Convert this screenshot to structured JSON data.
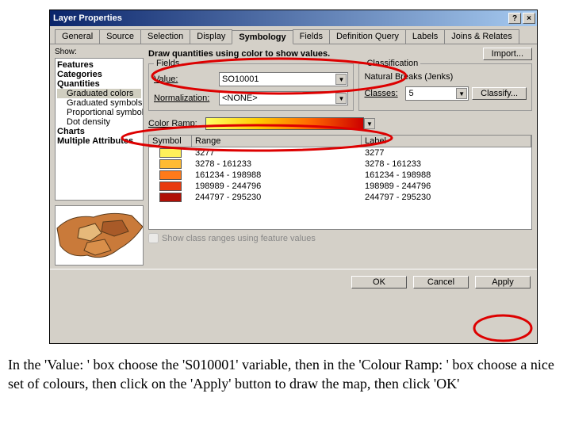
{
  "dialog": {
    "title": "Layer Properties",
    "help": "?",
    "close": "×",
    "tabs": [
      "General",
      "Source",
      "Selection",
      "Display",
      "Symbology",
      "Fields",
      "Definition Query",
      "Labels",
      "Joins & Relates"
    ],
    "activeTab": 4
  },
  "sidebar": {
    "showLabel": "Show:",
    "tree": {
      "features": "Features",
      "categories": "Categories",
      "quantities": "Quantities",
      "q_children": [
        "Graduated colors",
        "Graduated symbols",
        "Proportional symbols",
        "Dot density"
      ],
      "charts": "Charts",
      "multiattr": "Multiple Attributes"
    }
  },
  "main": {
    "drawText": "Draw quantities using color to show values.",
    "importBtn": "Import...",
    "fieldsLegend": "Fields",
    "classLegend": "Classification",
    "valueLabel": "Value:",
    "valueSel": "SO10001",
    "normLabel": "Normalization:",
    "normSel": "<NONE>",
    "classMethod": "Natural Breaks (Jenks)",
    "classesLabel": "Classes:",
    "classesVal": "5",
    "classifyBtn": "Classify...",
    "rampLabel": "Color Ramp:",
    "tableHead": {
      "c1": "Symbol",
      "c2": "Range",
      "c3": "Label"
    },
    "rows": [
      {
        "color": "#fff05a",
        "range": "3277",
        "label": "3277"
      },
      {
        "color": "#ffbb33",
        "range": "3278 - 161233",
        "label": "3278 - 161233"
      },
      {
        "color": "#ff7a1a",
        "range": "161234 - 198988",
        "label": "161234 - 198988"
      },
      {
        "color": "#e83a0f",
        "range": "198989 - 244796",
        "label": "198989 - 244796"
      },
      {
        "color": "#b01006",
        "range": "244797 - 295230",
        "label": "244797 - 295230"
      }
    ],
    "checkbox": "Show class ranges using feature values"
  },
  "buttons": {
    "ok": "OK",
    "cancel": "Cancel",
    "apply": "Apply"
  },
  "caption": {
    "p1a": "In the ",
    "v1": "'Value: '",
    "p1b": " box choose the ",
    "v2": "'S010001'",
    "p1c": " variable, then in the ",
    "v3": "'Colour Ramp: '",
    "p1d": " box choose a nice set of colours, then click on the ",
    "v4": "'Apply'",
    "p1e": " button to draw the map, then click ",
    "v5": "'OK'"
  }
}
